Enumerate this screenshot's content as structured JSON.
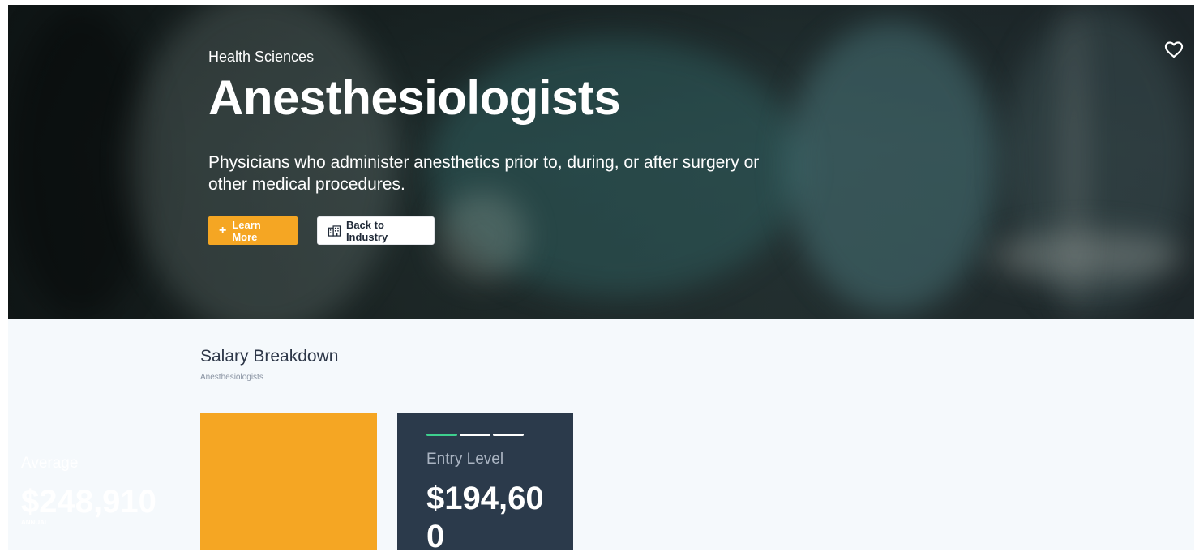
{
  "hero": {
    "category": "Health Sciences",
    "title": "Anesthesiologists",
    "description": "Physicians who administer anesthetics prior to, during, or after surgery or other medical procedures.",
    "learn_more_label": "Learn More",
    "back_label": "Back to Industry"
  },
  "salary": {
    "title": "Salary Breakdown",
    "subtitle": "Anesthesiologists",
    "cards": [
      {
        "label": "Average",
        "value": "$248,910",
        "unit": "ANNUAL"
      },
      {
        "label": "Entry Level",
        "value": "$194,600"
      }
    ]
  },
  "colors": {
    "accent": "#f5a623",
    "dark_card": "#2b3a4b",
    "indicator_active": "#3ecf8e",
    "page_bg": "#f5f9fc"
  },
  "icons": [
    "plus-icon",
    "building-icon",
    "heart-icon"
  ]
}
